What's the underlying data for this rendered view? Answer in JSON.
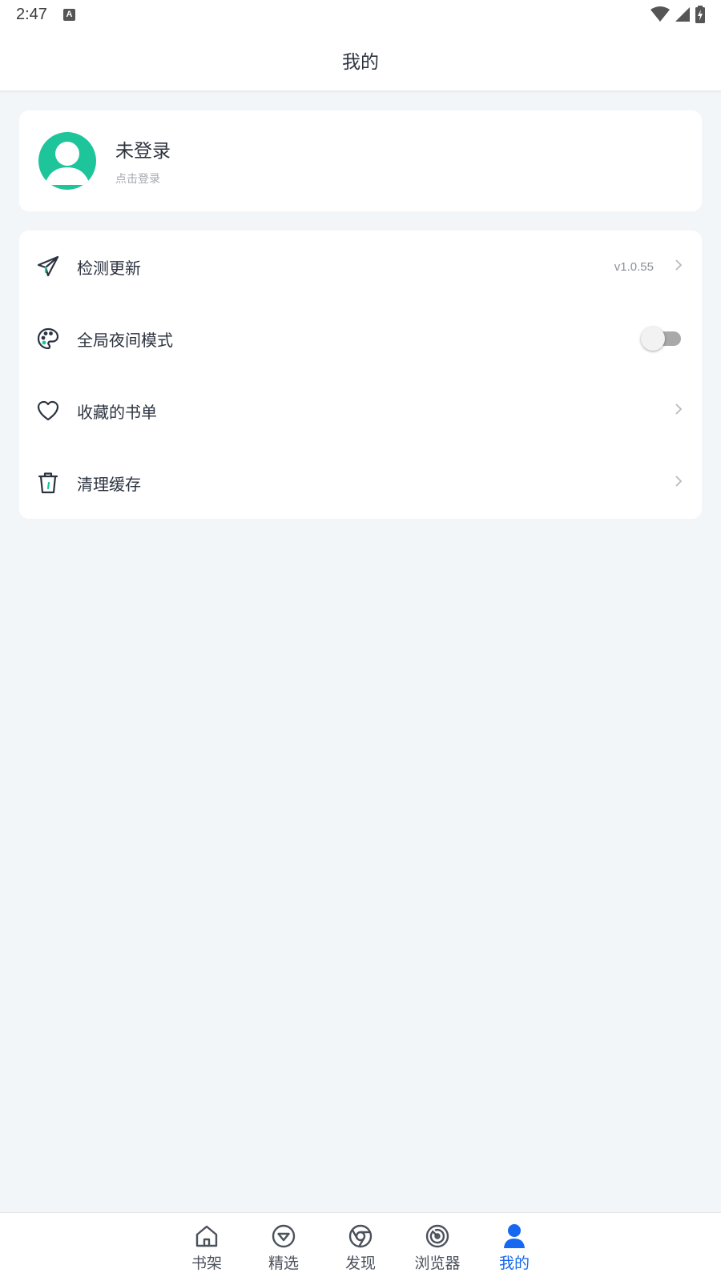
{
  "status_bar": {
    "time": "2:47",
    "notification_icon": "a-letter-icon",
    "icons": [
      "wifi-icon",
      "signal-icon",
      "battery-icon"
    ]
  },
  "header": {
    "title": "我的"
  },
  "profile": {
    "name": "未登录",
    "subtitle": "点击登录",
    "avatar_icon": "user-avatar-icon",
    "avatar_color": "#1ec59a"
  },
  "menu": {
    "check_update": {
      "label": "检测更新",
      "version": "v1.0.55",
      "icon": "paper-plane-icon"
    },
    "night_mode": {
      "label": "全局夜间模式",
      "enabled": false,
      "icon": "palette-icon"
    },
    "favorites": {
      "label": "收藏的书单",
      "icon": "heart-icon"
    },
    "clear_cache": {
      "label": "清理缓存",
      "icon": "trash-icon"
    }
  },
  "bottom_nav": {
    "items": [
      {
        "label": "书架",
        "icon": "home-icon",
        "active": false
      },
      {
        "label": "精选",
        "icon": "diamond-icon",
        "active": false
      },
      {
        "label": "发现",
        "icon": "aperture-icon",
        "active": false
      },
      {
        "label": "浏览器",
        "icon": "compass-icon",
        "active": false
      },
      {
        "label": "我的",
        "icon": "person-icon",
        "active": true
      }
    ],
    "active_color": "#1668f0"
  }
}
